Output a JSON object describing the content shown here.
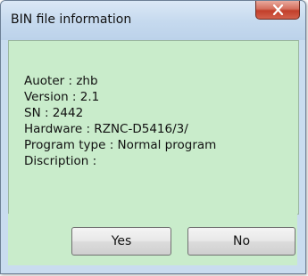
{
  "window": {
    "title": "BIN file information"
  },
  "info": {
    "lines": [
      "Auoter : zhb",
      "Version : 2.1",
      "SN : 2442",
      "Hardware : RZNC-D5416/3/",
      "Program type : Normal program",
      "Discription :"
    ]
  },
  "buttons": {
    "yes": "Yes",
    "no": "No"
  },
  "icons": {
    "close": "close-icon"
  },
  "colors": {
    "content_bg": "#c9eccb",
    "close_button": "#c23f2a"
  }
}
